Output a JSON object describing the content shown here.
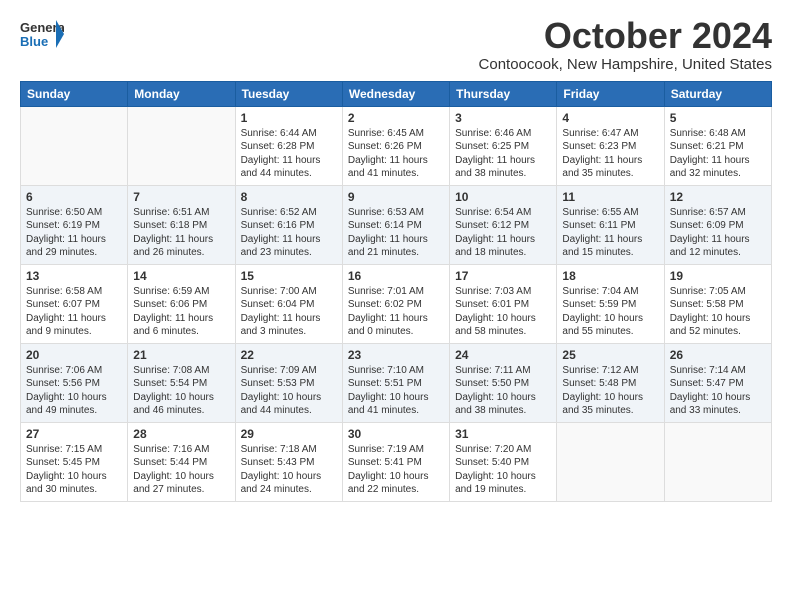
{
  "header": {
    "logo_general": "General",
    "logo_blue": "Blue",
    "month": "October 2024",
    "location": "Contoocook, New Hampshire, United States"
  },
  "columns": [
    "Sunday",
    "Monday",
    "Tuesday",
    "Wednesday",
    "Thursday",
    "Friday",
    "Saturday"
  ],
  "weeks": [
    [
      {
        "day": "",
        "content": ""
      },
      {
        "day": "",
        "content": ""
      },
      {
        "day": "1",
        "content": "Sunrise: 6:44 AM\nSunset: 6:28 PM\nDaylight: 11 hours and 44 minutes."
      },
      {
        "day": "2",
        "content": "Sunrise: 6:45 AM\nSunset: 6:26 PM\nDaylight: 11 hours and 41 minutes."
      },
      {
        "day": "3",
        "content": "Sunrise: 6:46 AM\nSunset: 6:25 PM\nDaylight: 11 hours and 38 minutes."
      },
      {
        "day": "4",
        "content": "Sunrise: 6:47 AM\nSunset: 6:23 PM\nDaylight: 11 hours and 35 minutes."
      },
      {
        "day": "5",
        "content": "Sunrise: 6:48 AM\nSunset: 6:21 PM\nDaylight: 11 hours and 32 minutes."
      }
    ],
    [
      {
        "day": "6",
        "content": "Sunrise: 6:50 AM\nSunset: 6:19 PM\nDaylight: 11 hours and 29 minutes."
      },
      {
        "day": "7",
        "content": "Sunrise: 6:51 AM\nSunset: 6:18 PM\nDaylight: 11 hours and 26 minutes."
      },
      {
        "day": "8",
        "content": "Sunrise: 6:52 AM\nSunset: 6:16 PM\nDaylight: 11 hours and 23 minutes."
      },
      {
        "day": "9",
        "content": "Sunrise: 6:53 AM\nSunset: 6:14 PM\nDaylight: 11 hours and 21 minutes."
      },
      {
        "day": "10",
        "content": "Sunrise: 6:54 AM\nSunset: 6:12 PM\nDaylight: 11 hours and 18 minutes."
      },
      {
        "day": "11",
        "content": "Sunrise: 6:55 AM\nSunset: 6:11 PM\nDaylight: 11 hours and 15 minutes."
      },
      {
        "day": "12",
        "content": "Sunrise: 6:57 AM\nSunset: 6:09 PM\nDaylight: 11 hours and 12 minutes."
      }
    ],
    [
      {
        "day": "13",
        "content": "Sunrise: 6:58 AM\nSunset: 6:07 PM\nDaylight: 11 hours and 9 minutes."
      },
      {
        "day": "14",
        "content": "Sunrise: 6:59 AM\nSunset: 6:06 PM\nDaylight: 11 hours and 6 minutes."
      },
      {
        "day": "15",
        "content": "Sunrise: 7:00 AM\nSunset: 6:04 PM\nDaylight: 11 hours and 3 minutes."
      },
      {
        "day": "16",
        "content": "Sunrise: 7:01 AM\nSunset: 6:02 PM\nDaylight: 11 hours and 0 minutes."
      },
      {
        "day": "17",
        "content": "Sunrise: 7:03 AM\nSunset: 6:01 PM\nDaylight: 10 hours and 58 minutes."
      },
      {
        "day": "18",
        "content": "Sunrise: 7:04 AM\nSunset: 5:59 PM\nDaylight: 10 hours and 55 minutes."
      },
      {
        "day": "19",
        "content": "Sunrise: 7:05 AM\nSunset: 5:58 PM\nDaylight: 10 hours and 52 minutes."
      }
    ],
    [
      {
        "day": "20",
        "content": "Sunrise: 7:06 AM\nSunset: 5:56 PM\nDaylight: 10 hours and 49 minutes."
      },
      {
        "day": "21",
        "content": "Sunrise: 7:08 AM\nSunset: 5:54 PM\nDaylight: 10 hours and 46 minutes."
      },
      {
        "day": "22",
        "content": "Sunrise: 7:09 AM\nSunset: 5:53 PM\nDaylight: 10 hours and 44 minutes."
      },
      {
        "day": "23",
        "content": "Sunrise: 7:10 AM\nSunset: 5:51 PM\nDaylight: 10 hours and 41 minutes."
      },
      {
        "day": "24",
        "content": "Sunrise: 7:11 AM\nSunset: 5:50 PM\nDaylight: 10 hours and 38 minutes."
      },
      {
        "day": "25",
        "content": "Sunrise: 7:12 AM\nSunset: 5:48 PM\nDaylight: 10 hours and 35 minutes."
      },
      {
        "day": "26",
        "content": "Sunrise: 7:14 AM\nSunset: 5:47 PM\nDaylight: 10 hours and 33 minutes."
      }
    ],
    [
      {
        "day": "27",
        "content": "Sunrise: 7:15 AM\nSunset: 5:45 PM\nDaylight: 10 hours and 30 minutes."
      },
      {
        "day": "28",
        "content": "Sunrise: 7:16 AM\nSunset: 5:44 PM\nDaylight: 10 hours and 27 minutes."
      },
      {
        "day": "29",
        "content": "Sunrise: 7:18 AM\nSunset: 5:43 PM\nDaylight: 10 hours and 24 minutes."
      },
      {
        "day": "30",
        "content": "Sunrise: 7:19 AM\nSunset: 5:41 PM\nDaylight: 10 hours and 22 minutes."
      },
      {
        "day": "31",
        "content": "Sunrise: 7:20 AM\nSunset: 5:40 PM\nDaylight: 10 hours and 19 minutes."
      },
      {
        "day": "",
        "content": ""
      },
      {
        "day": "",
        "content": ""
      }
    ]
  ]
}
